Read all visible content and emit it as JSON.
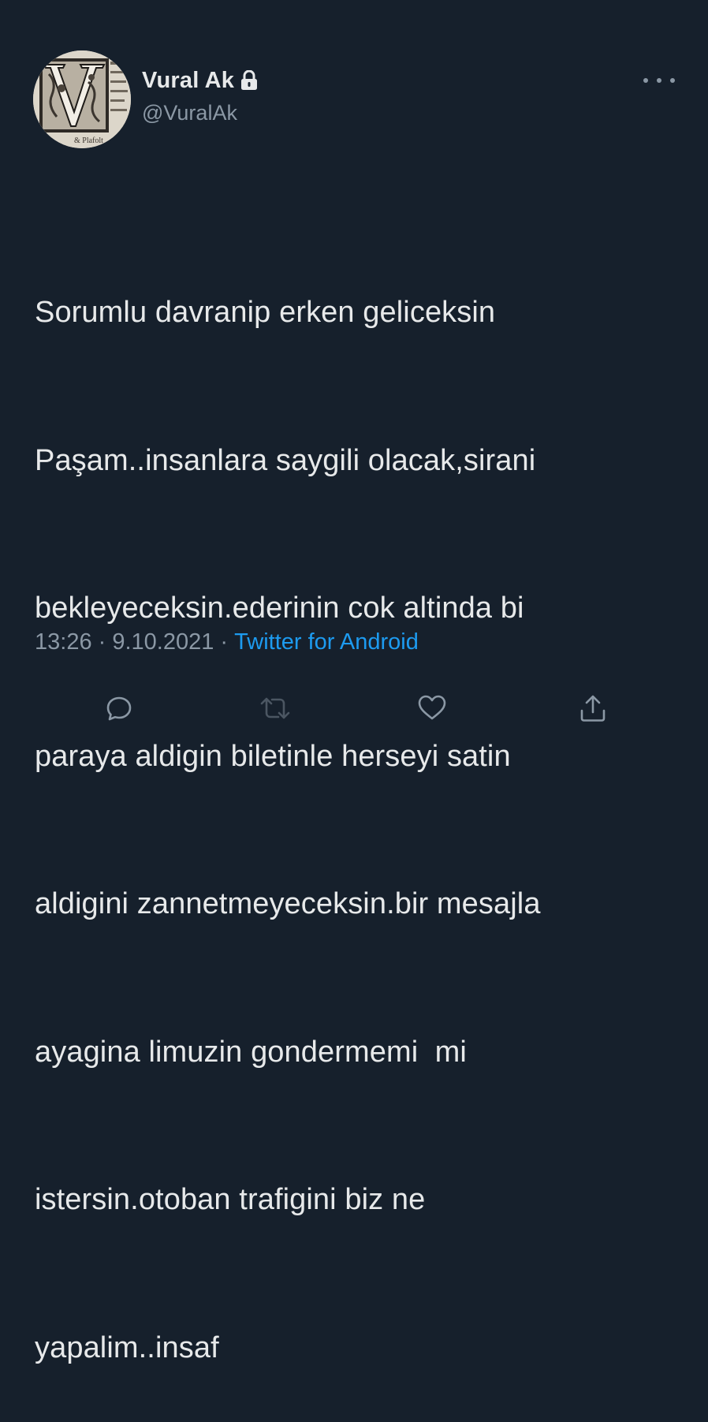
{
  "tweet": {
    "author": {
      "name": "Vural Ak",
      "handle": "@VuralAk",
      "protected_icon": "lock-icon",
      "avatar_text": "& Plafolt"
    },
    "text_lines": [
      "Sorumlu davranip erken geliceksin",
      "Paşam..insanlara saygili olacak,sirani",
      "bekleyeceksin.ederinin cok altinda bi",
      "paraya aldigin biletinle herseyi satin",
      "aldigini zannetmeyeceksin.bir mesajla",
      "ayagina limuzin gondermemi  mi",
      "istersin.otoban trafigini biz ne",
      "yapalim..insaf"
    ],
    "time": "13:26",
    "date": "9.10.2021",
    "separator": " · ",
    "source": "Twitter for Android"
  },
  "actions": [
    {
      "name": "reply",
      "icon": "reply-icon"
    },
    {
      "name": "retweet",
      "icon": "retweet-icon"
    },
    {
      "name": "like",
      "icon": "heart-icon"
    },
    {
      "name": "share",
      "icon": "share-icon"
    }
  ],
  "colors": {
    "background": "#16202c",
    "text": "#e7e9ea",
    "secondary": "#8b98a5",
    "accent": "#1d9bf0"
  }
}
